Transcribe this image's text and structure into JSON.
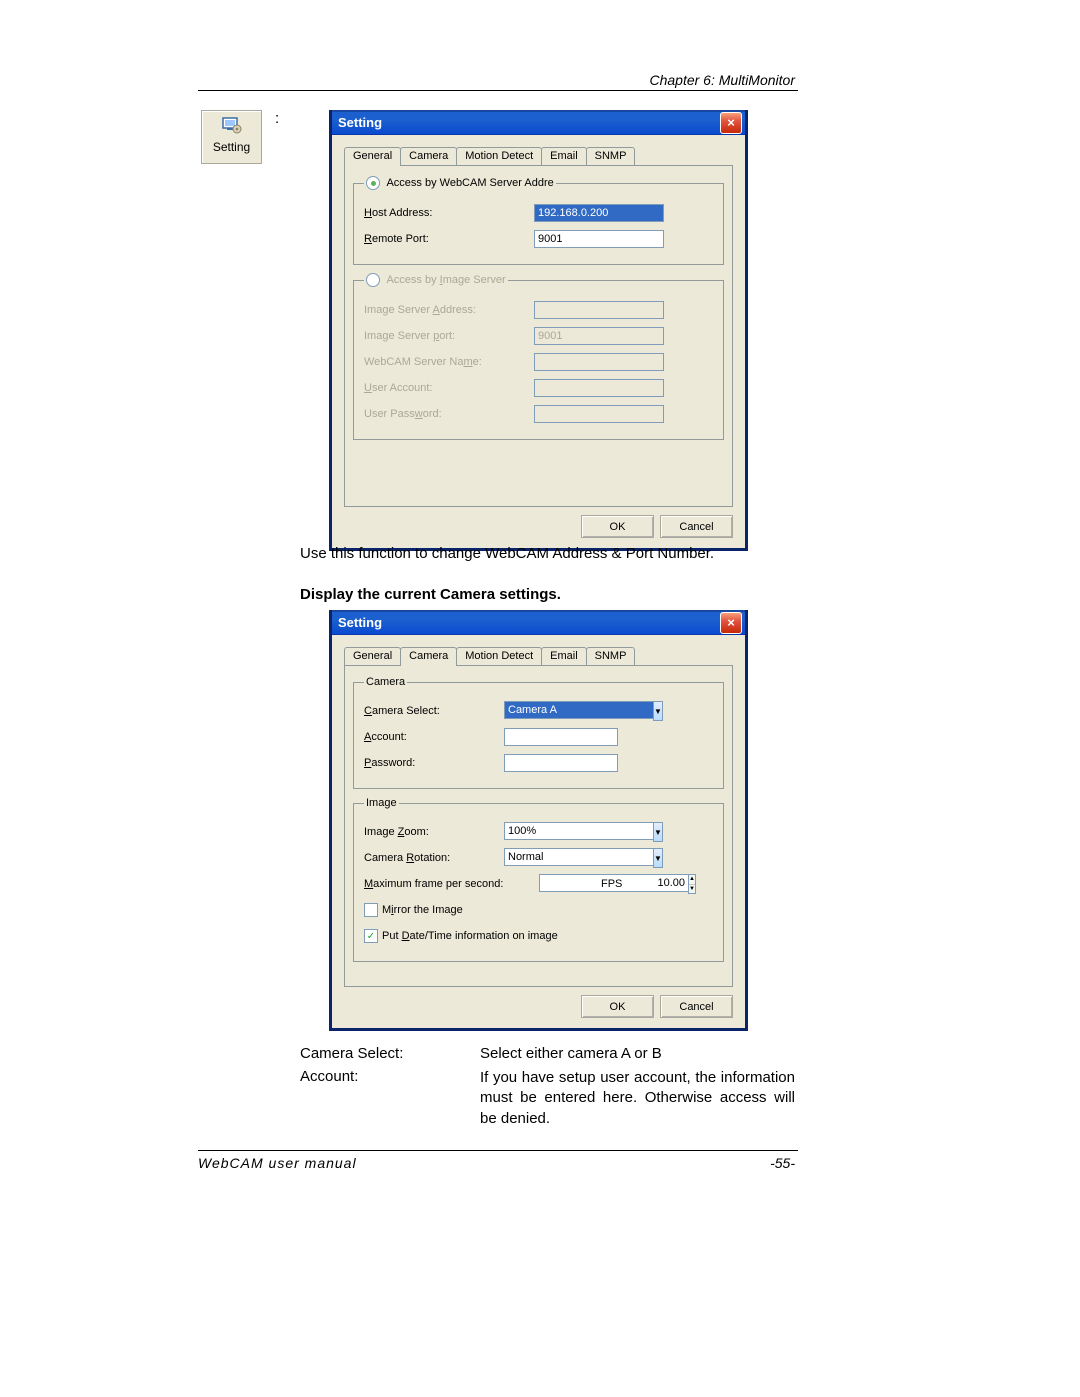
{
  "header": {
    "chapter": "Chapter 6: MultiMonitor"
  },
  "footer": {
    "manual": "WebCAM user manual",
    "page": "-55-"
  },
  "toolbar_button": {
    "label": "Setting",
    "colon": ":"
  },
  "text": {
    "use_function": "Use this function to change WebCAM Address & Port Number.",
    "display_settings": "Display the current Camera settings",
    "camera_select_label": "Camera Select:",
    "camera_select_desc": "Select either camera A or B",
    "account_label": "Account:",
    "account_desc": "If you have setup user account, the information must be entered here. Otherwise access will be denied."
  },
  "dialog1": {
    "title": "Setting",
    "close": "×",
    "tabs": {
      "general": "General",
      "camera": "Camera",
      "motion": "Motion Detect",
      "email": "Email",
      "snmp": "SNMP"
    },
    "group1": {
      "legend": "Access by WebCAM Server Addre",
      "host_label": "Host Address:",
      "host_value": "192.168.0.200",
      "port_label": "Remote Port:",
      "port_value": "9001"
    },
    "group2": {
      "legend": "Access by Image Server",
      "addr_label": "Image Server Address:",
      "addr_value": "",
      "port_label": "Image Server port:",
      "port_value": "9001",
      "name_label": "WebCAM Server Name:",
      "name_value": "",
      "user_label": "User Account:",
      "user_value": "",
      "pass_label": "User Password:",
      "pass_value": ""
    },
    "ok": "OK",
    "cancel": "Cancel"
  },
  "dialog2": {
    "title": "Setting",
    "close": "×",
    "tabs": {
      "general": "General",
      "camera": "Camera",
      "motion": "Motion Detect",
      "email": "Email",
      "snmp": "SNMP"
    },
    "camera_group": {
      "legend": "Camera",
      "select_label": "Camera Select:",
      "select_value": "Camera A",
      "account_label": "Account:",
      "account_value": "",
      "password_label": "Password:",
      "password_value": ""
    },
    "image_group": {
      "legend": "Image",
      "zoom_label": "Image Zoom:",
      "zoom_value": "100%",
      "rotation_label": "Camera Rotation:",
      "rotation_value": "Normal",
      "fps_label": "Maximum frame per second:",
      "fps_value": "10.00",
      "fps_suffix": "FPS",
      "mirror_label": "Mirror the Image",
      "datetime_label": "Put Date/Time information on image"
    },
    "ok": "OK",
    "cancel": "Cancel"
  }
}
